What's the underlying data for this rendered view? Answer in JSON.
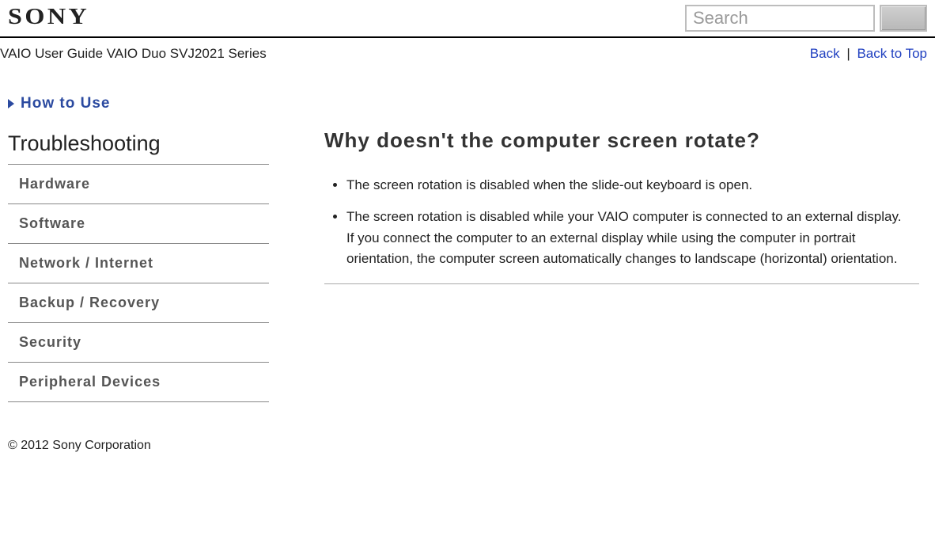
{
  "brand": "SONY",
  "search": {
    "placeholder": "Search"
  },
  "breadcrumb": "VAIO User Guide VAIO Duo SVJ2021 Series",
  "nav": {
    "back": "Back",
    "top": "Back to Top",
    "separator": "|"
  },
  "sidebar": {
    "howto": "How to Use",
    "section": "Troubleshooting",
    "items": [
      {
        "label": "Hardware"
      },
      {
        "label": "Software"
      },
      {
        "label": "Network / Internet"
      },
      {
        "label": "Backup / Recovery"
      },
      {
        "label": "Security"
      },
      {
        "label": "Peripheral Devices"
      }
    ]
  },
  "article": {
    "title": "Why doesn't the computer screen rotate?",
    "points": [
      {
        "text": "The screen rotation is disabled when the slide-out keyboard is open."
      },
      {
        "text": "The screen rotation is disabled while your VAIO computer is connected to an external display.",
        "extra": "If you connect the computer to an external display while using the computer in portrait orientation, the computer screen automatically changes to landscape (horizontal) orientation."
      }
    ]
  },
  "footer": "© 2012 Sony Corporation"
}
